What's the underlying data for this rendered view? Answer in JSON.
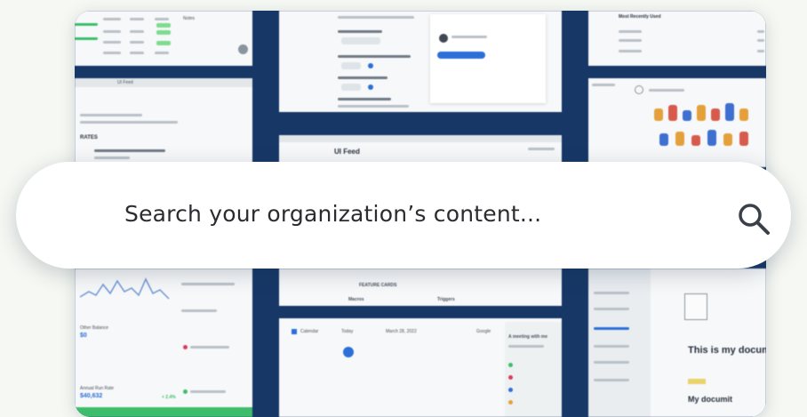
{
  "search": {
    "placeholder": "Search your organization’s content...",
    "icon": "magnifier-icon"
  },
  "panels": {
    "top_left": {
      "label_1": "Notes"
    },
    "left_mid": {
      "feed_label": "UI Feed",
      "title": "RATES"
    },
    "center_mid": {
      "title": "UI Feed"
    },
    "top_right": {
      "title": "Most Recently Used"
    },
    "bottom_left": {
      "label_1": "Other Balance",
      "value_1": "$0",
      "label_2": "Annual Run Rate",
      "value_2": "$40,632",
      "delta": "+ 2.4%"
    },
    "bottom_center": {
      "app_name": "Calendar",
      "today_label": "Today",
      "date_label": "March 28, 2022",
      "google_label": "Google",
      "event_title": "A meeting with me",
      "feature_label": "FEATURE CARDS",
      "col_1": "Macros",
      "col_2": "Triggers"
    },
    "bottom_right": {
      "doc_title": "This is my docum",
      "doc_subtitle": "My documit"
    }
  },
  "colors": {
    "frame": "#173867",
    "background": "#f6f8f3",
    "accent_green": "#3dbd6b",
    "accent_blue": "#2c6fd6"
  }
}
